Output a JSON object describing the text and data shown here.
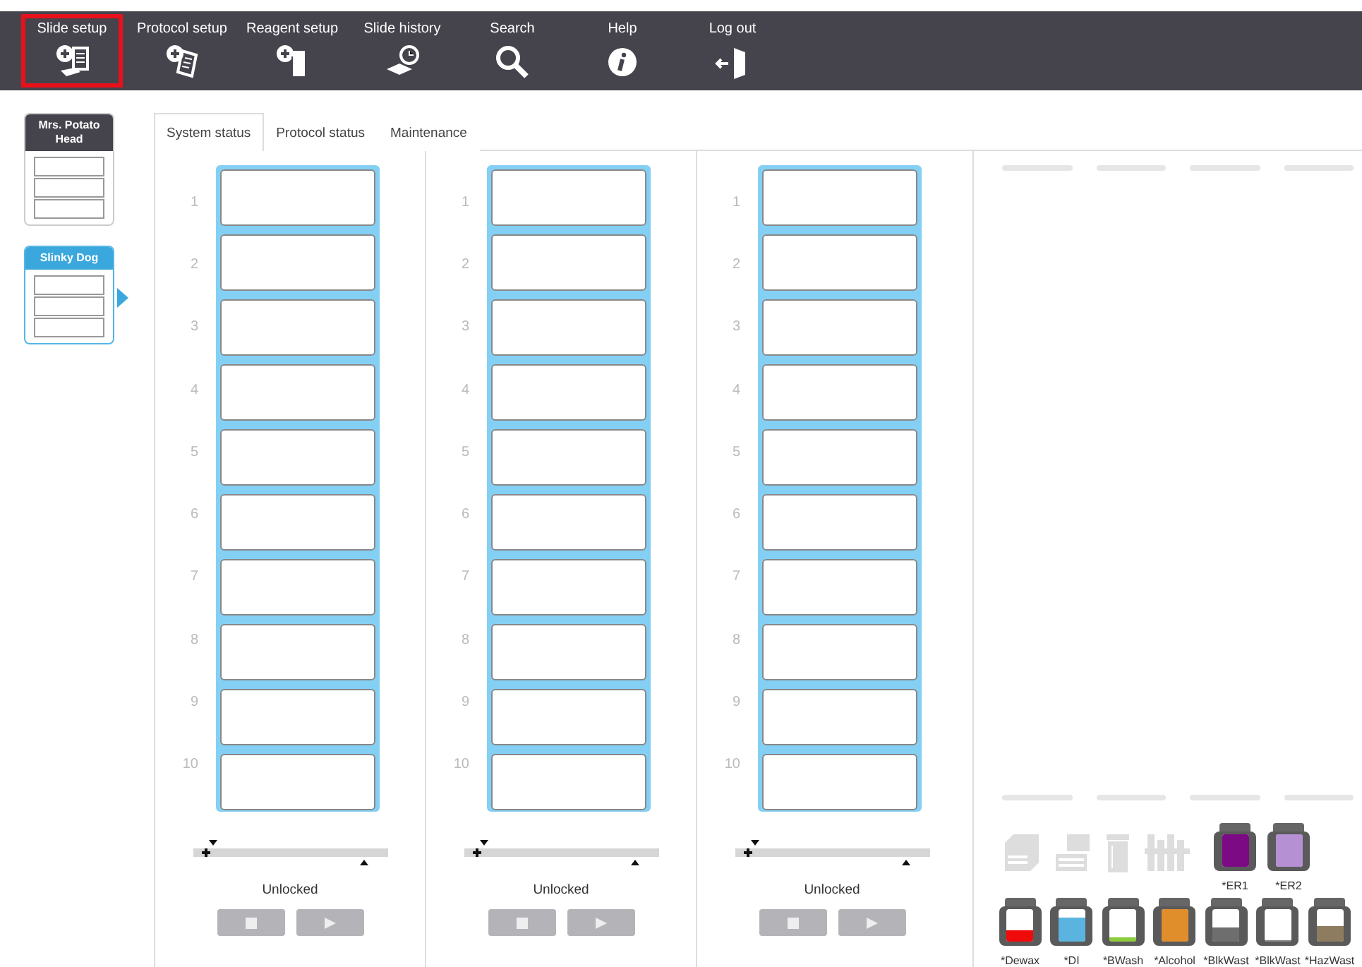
{
  "nav": [
    {
      "label": "Slide setup",
      "selected": true
    },
    {
      "label": "Protocol setup",
      "selected": false
    },
    {
      "label": "Reagent setup",
      "selected": false
    },
    {
      "label": "Slide history",
      "selected": false
    },
    {
      "label": "Search",
      "selected": false
    },
    {
      "label": "Help",
      "selected": false
    },
    {
      "label": "Log out",
      "selected": false
    }
  ],
  "instruments": [
    {
      "name": "Mrs. Potato Head",
      "selected": false
    },
    {
      "name": "Slinky Dog",
      "selected": true
    }
  ],
  "tabs": [
    {
      "label": "System status",
      "selected": true
    },
    {
      "label": "Protocol status",
      "selected": false
    },
    {
      "label": "Maintenance",
      "selected": false
    }
  ],
  "trays": [
    {
      "slots": [
        "1",
        "2",
        "3",
        "4",
        "5",
        "6",
        "7",
        "8",
        "9",
        "10"
      ],
      "status": "Unlocked"
    },
    {
      "slots": [
        "1",
        "2",
        "3",
        "4",
        "5",
        "6",
        "7",
        "8",
        "9",
        "10"
      ],
      "status": "Unlocked"
    },
    {
      "slots": [
        "1",
        "2",
        "3",
        "4",
        "5",
        "6",
        "7",
        "8",
        "9",
        "10"
      ],
      "status": "Unlocked"
    }
  ],
  "upper_containers": [
    {
      "label": "*ER1",
      "level": 1,
      "color": "#7b0a84"
    },
    {
      "label": "*ER2",
      "level": 1,
      "color": "#b590d2"
    }
  ],
  "bulk_containers": [
    {
      "label": "*Dewax",
      "level": 0.35,
      "color": "#f00a0a"
    },
    {
      "label": "*DI",
      "level": 0.75,
      "color": "#5bb4e0"
    },
    {
      "label": "*BWash",
      "level": 0.15,
      "color": "#8ccc3c"
    },
    {
      "label": "*Alcohol",
      "level": 1,
      "color": "#e08e2c"
    },
    {
      "label": "*BlkWast",
      "level": 0.45,
      "color": "#6e6e6e"
    },
    {
      "label": "*BlkWast",
      "level": 0.05,
      "color": "#8a8a8a"
    },
    {
      "label": "*HazWast",
      "level": 0.5,
      "color": "#8e7c60"
    }
  ]
}
